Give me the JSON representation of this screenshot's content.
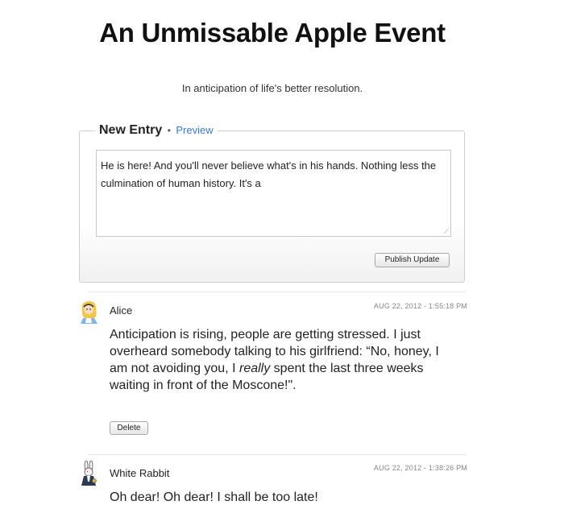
{
  "page": {
    "title": "An Unmissable Apple Event",
    "tagline": "In anticipation of life's better resolution."
  },
  "new_entry": {
    "legend_title": "New Entry",
    "separator": "•",
    "preview_link": "Preview",
    "textarea_value": "He is here! And you'll never believe what's in his hands. Nothing less the culmination of human history. It's a",
    "publish_label": "Publish Update"
  },
  "posts": [
    {
      "author": "Alice",
      "timestamp": "AUG 22, 2012 - 1:55:18 PM",
      "body_before": "Anticipation is rising, people are getting stressed. I just overheard somebody talking to his girlfriend: “No, honey, I am not avoiding you, I ",
      "body_emphasis": "really",
      "body_after": " spent the last three weeks waiting in front of the Moscone!\".",
      "delete_label": "Delete",
      "avatar_icon": "alice-avatar-icon"
    },
    {
      "author": "White Rabbit",
      "timestamp": "AUG 22, 2012 - 1:38:26 PM",
      "body": "Oh dear! Oh dear! I shall be too late!",
      "avatar_icon": "white-rabbit-avatar-icon"
    }
  ]
}
